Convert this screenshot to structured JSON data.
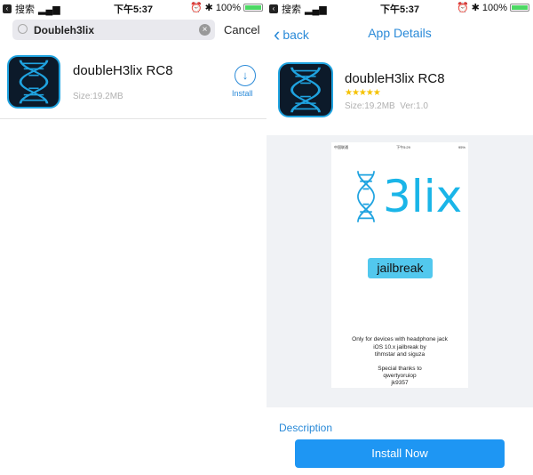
{
  "status_bar": {
    "back_app": "搜索",
    "time": "下午5:37",
    "battery": "100%"
  },
  "search_screen": {
    "query": "Doubleh3lix",
    "cancel_label": "Cancel",
    "result": {
      "name": "doubleH3lix RC8",
      "size": "Size:19.2MB",
      "install_label": "Install",
      "install_icon": "download-arrow-icon"
    }
  },
  "details_screen": {
    "back_label": "back",
    "title": "App Details",
    "app": {
      "name": "doubleH3lix RC8",
      "rating": 5,
      "stars": "★★★★★",
      "size": "Size:19.2MB",
      "version": "Ver:1.0"
    },
    "screenshot": {
      "status_carrier": "中国联通",
      "status_time": "下午5:29",
      "status_battery": "95%",
      "logo_text": "3lix",
      "button": "jailbreak",
      "line1": "Only for devices with headphone jack",
      "line2": "iOS 10.x jailbreak by",
      "line3": "tihmstar and siguza",
      "line4": "Special thanks to",
      "line5": "qwertyoruiop",
      "line6": "jk9357"
    },
    "description_label": "Description",
    "install_now_label": "Install Now"
  },
  "colors": {
    "accent": "#1e96f3",
    "link": "#2a8ad8",
    "star": "#f5c200",
    "logo": "#1ab5e8"
  }
}
